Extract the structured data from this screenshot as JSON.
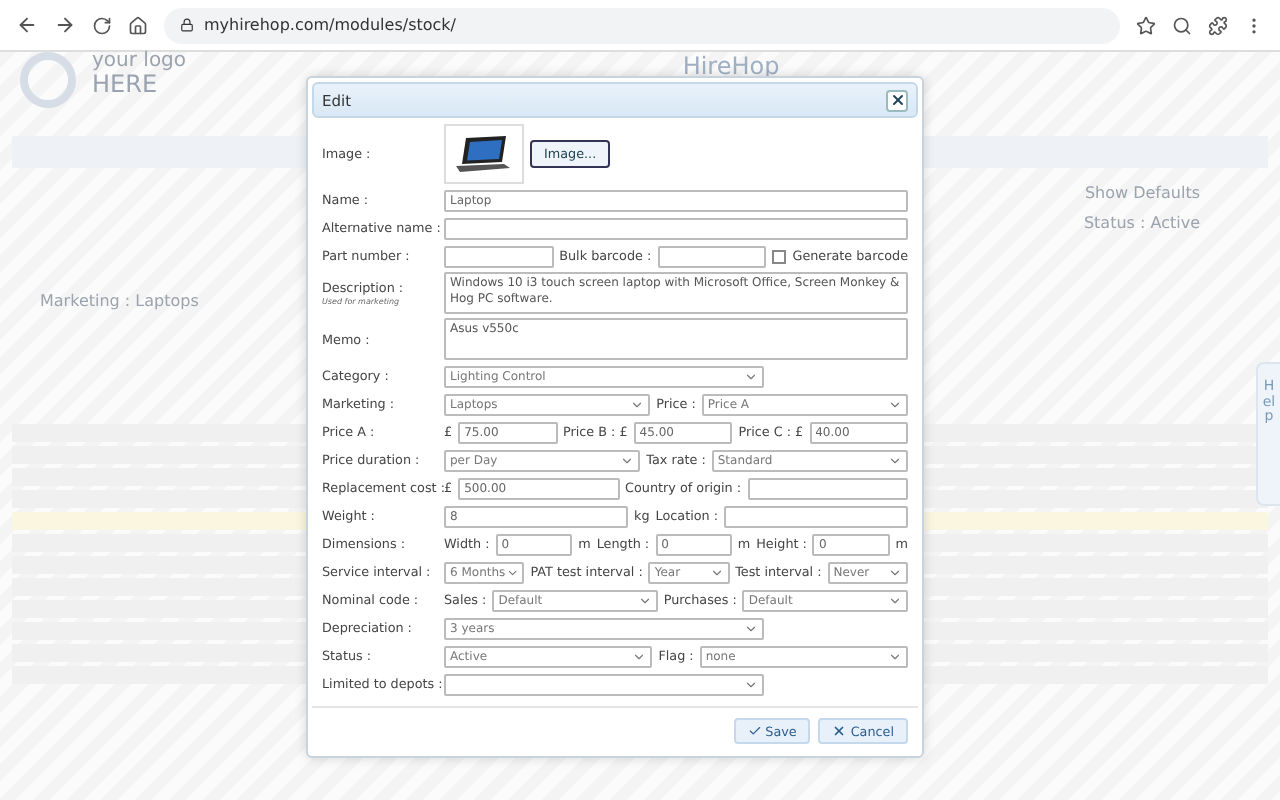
{
  "browser": {
    "url": "myhirehop.com/modules/stock/"
  },
  "page": {
    "logo_top": "your logo",
    "logo_bottom": "HERE",
    "app_title": "HireHop",
    "show_defaults": "Show Defaults",
    "status": "Status : Active",
    "marketing": "Marketing : Laptops",
    "help": "Help"
  },
  "dialog": {
    "title": "Edit",
    "image_label": "Image :",
    "image_button": "Image...",
    "rows": [
      {
        "items": [
          {
            "kind": "label",
            "text": "Name :"
          },
          {
            "kind": "input",
            "value": "Laptop"
          }
        ]
      },
      {
        "items": [
          {
            "kind": "label",
            "text": "Alternative name :"
          },
          {
            "kind": "input",
            "value": ""
          }
        ]
      },
      {
        "items": [
          {
            "kind": "label",
            "text": "Part number :"
          },
          {
            "kind": "input",
            "value": ""
          },
          {
            "kind": "text",
            "text": "Bulk barcode :"
          },
          {
            "kind": "input",
            "value": ""
          },
          {
            "kind": "checkbox",
            "text": "Generate barcode",
            "checked": false
          }
        ]
      },
      {
        "items": [
          {
            "kind": "label",
            "text": "Description :",
            "note": "Used for marketing"
          },
          {
            "kind": "textarea",
            "value": "Windows 10 i3 touch screen laptop with Microsoft Office, Screen Monkey & Hog PC software."
          }
        ]
      },
      {
        "items": [
          {
            "kind": "label",
            "text": "Memo :"
          },
          {
            "kind": "textarea",
            "value": "Asus v550c"
          }
        ]
      },
      {
        "items": [
          {
            "kind": "label",
            "text": "Category :"
          },
          {
            "kind": "select",
            "value": "Lighting Control"
          },
          {
            "kind": "spacer"
          }
        ]
      },
      {
        "items": [
          {
            "kind": "label",
            "text": "Marketing :"
          },
          {
            "kind": "select",
            "value": "Laptops"
          },
          {
            "kind": "text",
            "text": "Price :"
          },
          {
            "kind": "select",
            "value": "Price A"
          }
        ]
      },
      {
        "items": [
          {
            "kind": "label",
            "text": "Price A :"
          },
          {
            "kind": "text",
            "text": "£"
          },
          {
            "kind": "input",
            "value": "75.00"
          },
          {
            "kind": "text",
            "text": "Price B : £"
          },
          {
            "kind": "input",
            "value": "45.00"
          },
          {
            "kind": "text",
            "text": "Price C : £"
          },
          {
            "kind": "input",
            "value": "40.00"
          }
        ]
      },
      {
        "items": [
          {
            "kind": "label",
            "text": "Price duration :"
          },
          {
            "kind": "select",
            "value": "per Day"
          },
          {
            "kind": "text",
            "text": "Tax rate :"
          },
          {
            "kind": "select",
            "value": "Standard"
          }
        ]
      },
      {
        "items": [
          {
            "kind": "label",
            "text": "Replacement cost :"
          },
          {
            "kind": "text",
            "text": "£"
          },
          {
            "kind": "input",
            "value": "500.00"
          },
          {
            "kind": "text",
            "text": "Country of origin :"
          },
          {
            "kind": "input",
            "value": ""
          }
        ]
      },
      {
        "items": [
          {
            "kind": "label",
            "text": "Weight :"
          },
          {
            "kind": "input",
            "value": "8"
          },
          {
            "kind": "text",
            "text": "kg"
          },
          {
            "kind": "text",
            "text": "Location :"
          },
          {
            "kind": "input",
            "value": ""
          }
        ]
      },
      {
        "items": [
          {
            "kind": "label",
            "text": "Dimensions :"
          },
          {
            "kind": "text",
            "text": "Width :"
          },
          {
            "kind": "input",
            "value": "0"
          },
          {
            "kind": "text",
            "text": "m"
          },
          {
            "kind": "text",
            "text": "Length :"
          },
          {
            "kind": "input",
            "value": "0"
          },
          {
            "kind": "text",
            "text": "m"
          },
          {
            "kind": "text",
            "text": "Height :"
          },
          {
            "kind": "input",
            "value": "0"
          },
          {
            "kind": "text",
            "text": "m"
          }
        ]
      },
      {
        "items": [
          {
            "kind": "label",
            "text": "Service interval :"
          },
          {
            "kind": "select",
            "value": "6 Months"
          },
          {
            "kind": "text",
            "text": "PAT test interval :"
          },
          {
            "kind": "select",
            "value": "Year"
          },
          {
            "kind": "text",
            "text": "Test interval :"
          },
          {
            "kind": "select",
            "value": "Never"
          }
        ]
      },
      {
        "items": [
          {
            "kind": "label",
            "text": "Nominal code :"
          },
          {
            "kind": "text",
            "text": "Sales :"
          },
          {
            "kind": "select",
            "value": "Default"
          },
          {
            "kind": "text",
            "text": "Purchases :"
          },
          {
            "kind": "select",
            "value": "Default"
          }
        ]
      },
      {
        "items": [
          {
            "kind": "label",
            "text": "Depreciation :"
          },
          {
            "kind": "select",
            "value": "3 years"
          },
          {
            "kind": "spacer"
          }
        ]
      },
      {
        "items": [
          {
            "kind": "label",
            "text": "Status :"
          },
          {
            "kind": "select",
            "value": "Active"
          },
          {
            "kind": "text",
            "text": "Flag :"
          },
          {
            "kind": "select",
            "value": "none"
          }
        ]
      },
      {
        "items": [
          {
            "kind": "label",
            "text": "Limited to depots :"
          },
          {
            "kind": "select",
            "value": ""
          },
          {
            "kind": "spacer"
          }
        ]
      }
    ],
    "buttons": [
      {
        "kind": "save",
        "label": "Save"
      },
      {
        "kind": "cancel",
        "label": "Cancel"
      }
    ]
  }
}
